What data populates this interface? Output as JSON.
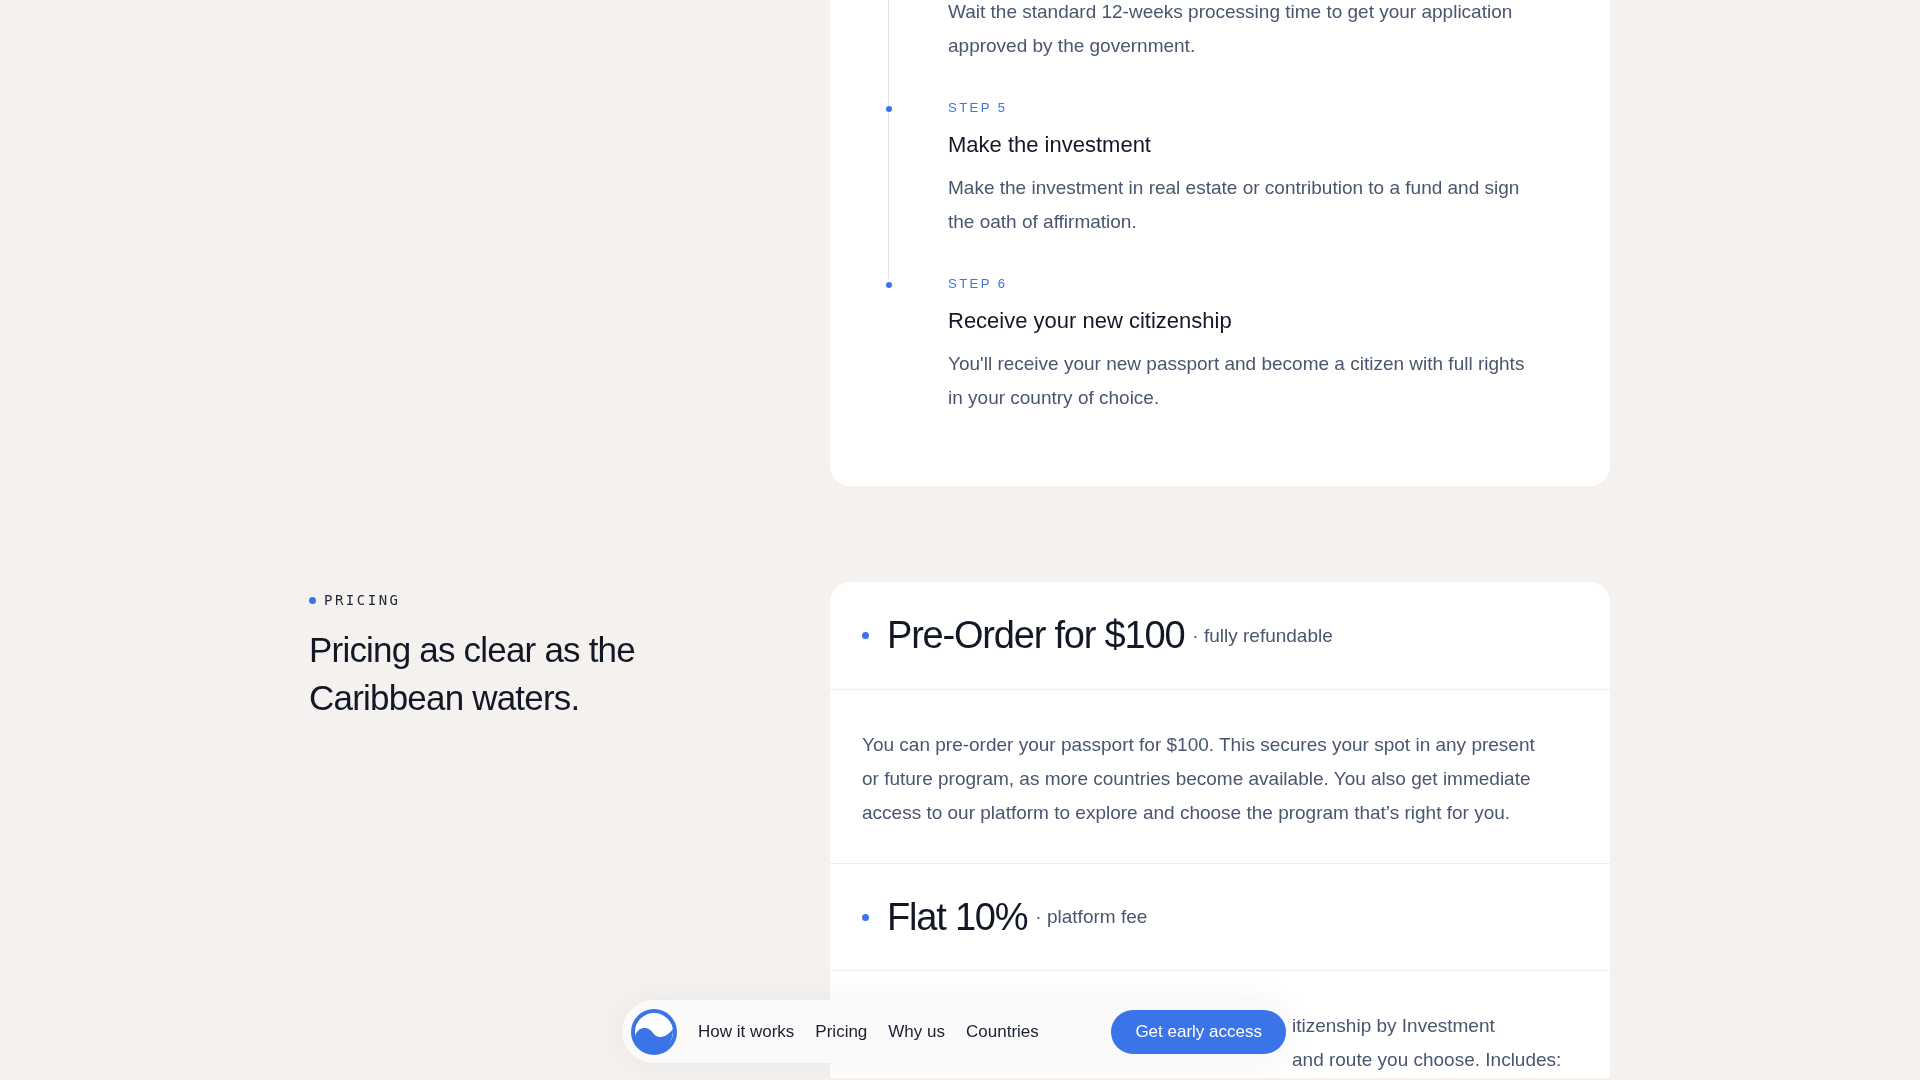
{
  "steps": [
    {
      "description": "Wait the standard 12-weeks processing time to get your application approved by the government."
    },
    {
      "label": "STEP 5",
      "title": "Make the investment",
      "description": "Make the investment in real estate or contribution to a fund and sign the oath of affirmation."
    },
    {
      "label": "STEP 6",
      "title": "Receive your new citizenship",
      "description": "You'll receive your new passport and become a citizen with full rights in your country of choice."
    }
  ],
  "pricing_section": {
    "eyebrow": "PRICING",
    "heading": "Pricing as clear as the Caribbean waters."
  },
  "pricing_items": [
    {
      "title": "Pre-Order for $100",
      "note": "· fully refundable",
      "description": "You can pre-order your passport for $100. This secures your spot in any present or future program, as more countries become available. You also get immediate access to our platform to explore and choose the program that’s right for you."
    },
    {
      "title": "Flat 10%",
      "note": "· platform fee",
      "description_fragments": [
        "itizenship by Investment",
        "and route you choose. Includes:"
      ]
    }
  ],
  "nav": {
    "links": [
      "How it works",
      "Pricing",
      "Why us",
      "Countries"
    ],
    "cta": "Get early access"
  }
}
